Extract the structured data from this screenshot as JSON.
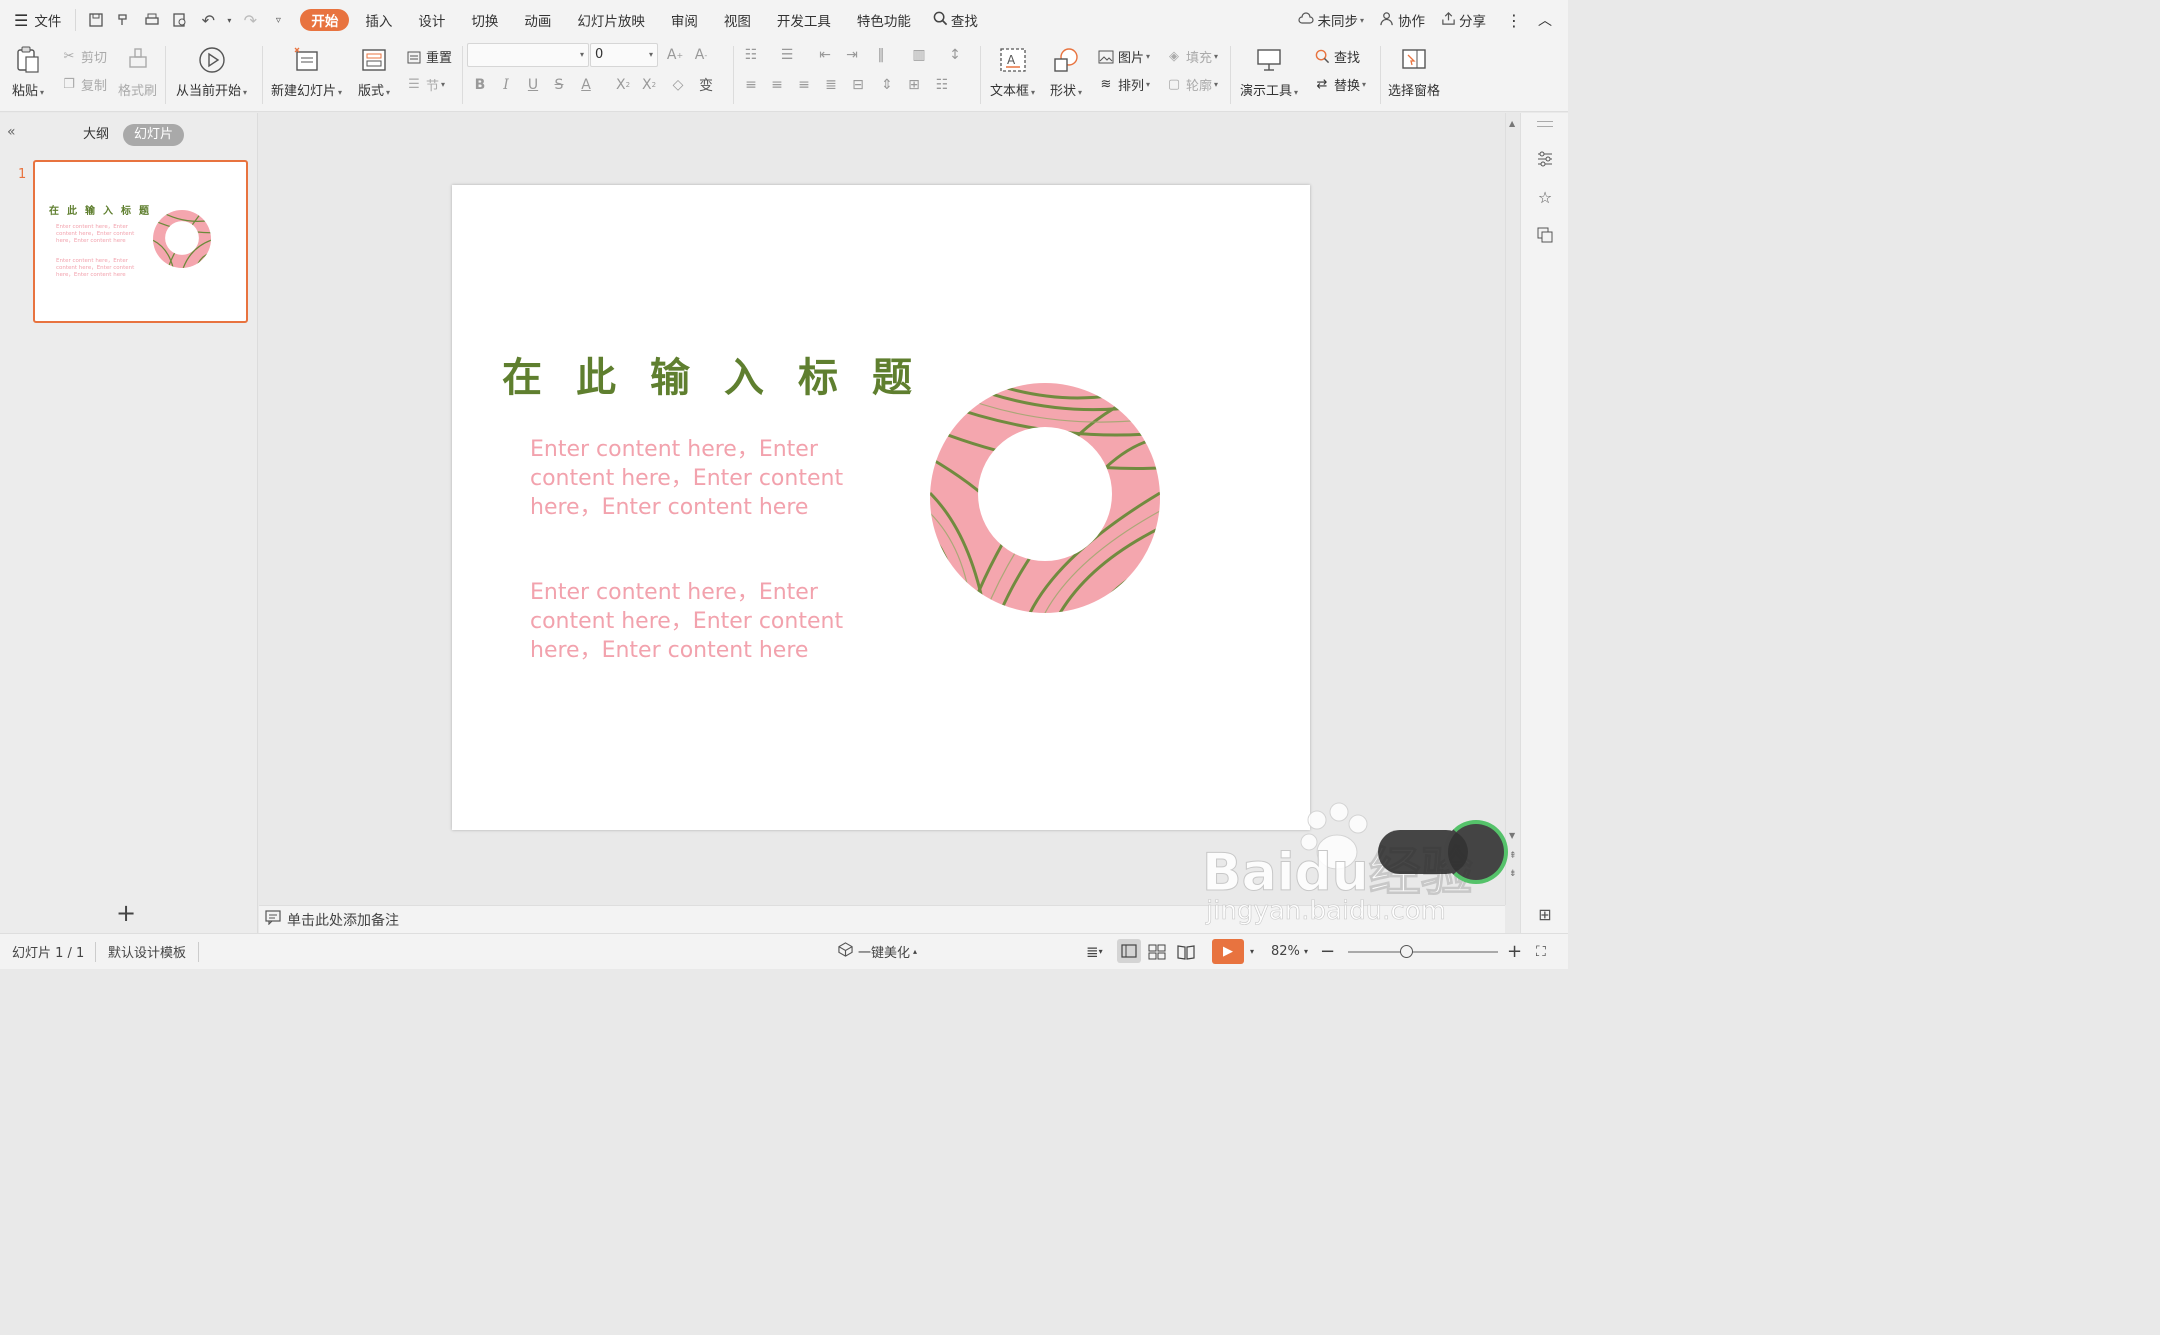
{
  "menubar": {
    "file_label": "文件",
    "tabs": [
      "开始",
      "插入",
      "设计",
      "切换",
      "动画",
      "幻灯片放映",
      "审阅",
      "视图",
      "开发工具",
      "特色功能"
    ],
    "search_label": "查找",
    "sync_label": "未同步",
    "collab_label": "协作",
    "share_label": "分享"
  },
  "ribbon": {
    "paste": "粘贴",
    "cut": "剪切",
    "copy": "复制",
    "format_painter": "格式刷",
    "from_current": "从当前开始",
    "new_slide": "新建幻灯片",
    "layout": "版式",
    "reset": "重置",
    "section": "节",
    "font_name": "",
    "font_size": "0",
    "textbox": "文本框",
    "shape": "形状",
    "picture": "图片",
    "fill": "填充",
    "arrange": "排列",
    "outline": "轮廓",
    "present_tools": "演示工具",
    "find": "查找",
    "replace": "替换",
    "select_pane": "选择窗格"
  },
  "leftpanel": {
    "outline_tab": "大纲",
    "slides_tab": "幻灯片",
    "slide_number": "1"
  },
  "slide": {
    "title": "在此输入标题",
    "paragraph1": "Enter content here，Enter content here，Enter content here，Enter content here",
    "paragraph2": "Enter content here，Enter content here，Enter content here，Enter content here"
  },
  "notes": {
    "placeholder": "单击此处添加备注"
  },
  "statusbar": {
    "slide_info": "幻灯片 1 / 1",
    "template": "默认设计模板",
    "beautify": "一键美化",
    "zoom": "82%"
  },
  "watermark": {
    "text": "Baidu经验",
    "url": "jingyan.baidu.com"
  },
  "colors": {
    "accent": "#e8733f",
    "title_green": "#5f7f2f",
    "body_pink": "#f2a2ad",
    "ring_pink": "#f4a6ae",
    "leaf_green": "#6b8a3a"
  }
}
